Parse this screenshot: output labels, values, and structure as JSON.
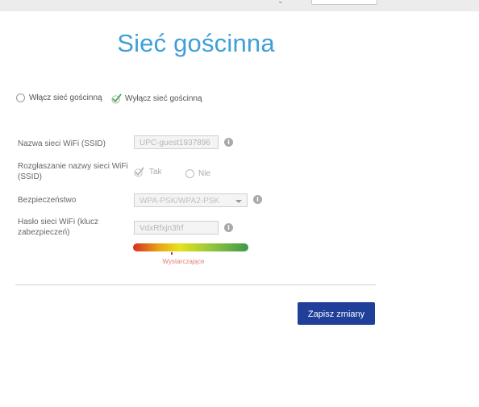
{
  "title": "Sieć gościnna",
  "guest_toggle": {
    "enable_label": "Włącz sieć gościnną",
    "disable_label": "Wyłącz sieć gościnną",
    "selected": "disable"
  },
  "fields": {
    "ssid_label": "Nazwa sieci WiFi (SSID)",
    "ssid_value": "UPC-guest1937896",
    "broadcast_label_line1": "Rozgłaszanie nazwy sieci WiFi",
    "broadcast_label_line2": "(SSID)",
    "broadcast_yes": "Tak",
    "broadcast_no": "Nie",
    "broadcast_selected": "yes",
    "security_label": "Bezpieczeństwo",
    "security_value": "WPA-PSK/WPA2-PSK",
    "password_label_line1": "Hasło sieci WiFi (klucz",
    "password_label_line2": "zabezpieczeń)",
    "password_value": "VdxRfxjn3frf"
  },
  "strength": {
    "label": "Wystarczające",
    "level": 0.33
  },
  "actions": {
    "save_label": "Zapisz zmiany"
  },
  "colors": {
    "title": "#3f9fd8",
    "button": "#1f3f99",
    "check": "#4caf50"
  }
}
